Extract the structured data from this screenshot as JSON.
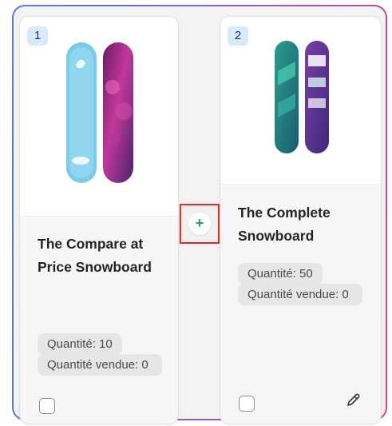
{
  "cards": [
    {
      "badge": "1",
      "title": "The Compare at Price Snowboard",
      "quantity": "Quantité: 10",
      "sold": "Quantité vendue: 0",
      "image_icon": "snowboard-pair-blue-purple"
    },
    {
      "badge": "2",
      "title": "The Complete Snowboard",
      "quantity": "Quantité: 50",
      "sold": "Quantité vendue: 0",
      "image_icon": "snowboard-pair-teal-purple"
    }
  ],
  "add_button": {
    "symbol": "+"
  },
  "colors": {
    "frame_gradient": [
      "#4f7fe0",
      "#d9467a"
    ],
    "badge_bg": "#d8e9fb",
    "add_border": "#e02b1f",
    "add_plus": "#2a9d6b"
  }
}
